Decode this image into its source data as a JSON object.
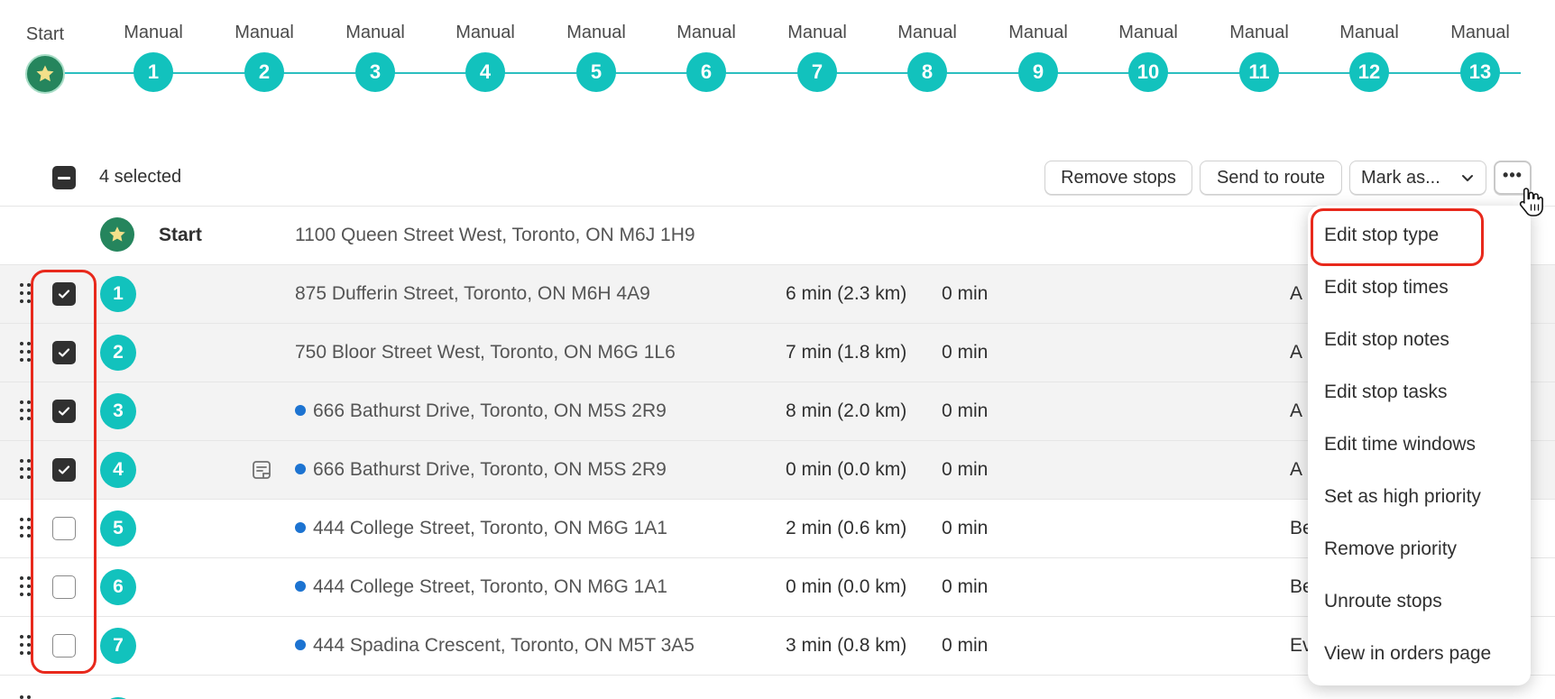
{
  "timeline": {
    "start_label": "Start",
    "steps": [
      {
        "label": "Manual",
        "number": "1"
      },
      {
        "label": "Manual",
        "number": "2"
      },
      {
        "label": "Manual",
        "number": "3"
      },
      {
        "label": "Manual",
        "number": "4"
      },
      {
        "label": "Manual",
        "number": "5"
      },
      {
        "label": "Manual",
        "number": "6"
      },
      {
        "label": "Manual",
        "number": "7"
      },
      {
        "label": "Manual",
        "number": "8"
      },
      {
        "label": "Manual",
        "number": "9"
      },
      {
        "label": "Manual",
        "number": "10"
      },
      {
        "label": "Manual",
        "number": "11"
      },
      {
        "label": "Manual",
        "number": "12"
      },
      {
        "label": "Manual",
        "number": "13"
      }
    ]
  },
  "toolbar": {
    "selected_text": "4 selected",
    "remove_label": "Remove stops",
    "send_label": "Send to route",
    "mark_label": "Mark as...",
    "more_label": "•••"
  },
  "table": {
    "start_row": {
      "label": "Start",
      "address": "1100 Queen Street West, Toronto, ON M6J 1H9"
    },
    "rows": [
      {
        "number": "1",
        "address": "875 Dufferin Street, Toronto, ON M6H 4A9",
        "dot": false,
        "note": false,
        "travel": "6 min (2.3 km)",
        "service": "0 min",
        "extra": "A",
        "checked": true
      },
      {
        "number": "2",
        "address": "750 Bloor Street West, Toronto, ON M6G 1L6",
        "dot": false,
        "note": false,
        "travel": "7 min (1.8 km)",
        "service": "0 min",
        "extra": "A",
        "checked": true
      },
      {
        "number": "3",
        "address": "666 Bathurst Drive, Toronto, ON M5S 2R9",
        "dot": true,
        "note": false,
        "travel": "8 min (2.0 km)",
        "service": "0 min",
        "extra": "A",
        "checked": true
      },
      {
        "number": "4",
        "address": "666 Bathurst Drive, Toronto, ON M5S 2R9",
        "dot": true,
        "note": true,
        "travel": "0 min (0.0 km)",
        "service": "0 min",
        "extra": "A",
        "checked": true
      },
      {
        "number": "5",
        "address": "444 College Street, Toronto, ON M6G 1A1",
        "dot": true,
        "note": false,
        "travel": "2 min (0.6 km)",
        "service": "0 min",
        "extra": "Be",
        "checked": false
      },
      {
        "number": "6",
        "address": "444 College Street, Toronto, ON M6G 1A1",
        "dot": true,
        "note": false,
        "travel": "0 min (0.0 km)",
        "service": "0 min",
        "extra": "Be",
        "checked": false
      },
      {
        "number": "7",
        "address": "444 Spadina Crescent, Toronto, ON M5T 3A5",
        "dot": true,
        "note": false,
        "travel": "3 min (0.8 km)",
        "service": "0 min",
        "extra": "Ev",
        "checked": false
      }
    ]
  },
  "menu": {
    "items": [
      "Edit stop type",
      "Edit stop times",
      "Edit stop notes",
      "Edit stop tasks",
      "Edit time windows",
      "Set as high priority",
      "Remove priority",
      "Unroute stops",
      "View in orders page"
    ]
  },
  "colors": {
    "teal": "#12c2bd",
    "start_green": "#25855d",
    "highlight_red": "#e8291c",
    "dot_blue": "#1c73d1"
  }
}
